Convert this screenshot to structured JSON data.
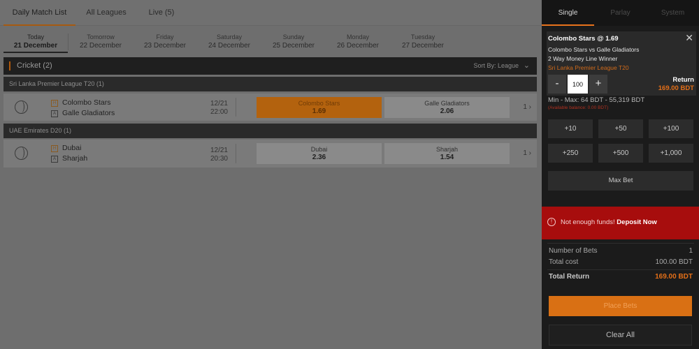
{
  "left": {
    "tabs": [
      {
        "label": "Daily Match List",
        "active": true
      },
      {
        "label": "All Leagues",
        "active": false
      },
      {
        "label": "Live (5)",
        "active": false
      }
    ],
    "dates": [
      {
        "day": "Today",
        "date": "21 December",
        "active": true
      },
      {
        "day": "Tomorrow",
        "date": "22 December"
      },
      {
        "day": "Friday",
        "date": "23 December"
      },
      {
        "day": "Saturday",
        "date": "24 December"
      },
      {
        "day": "Sunday",
        "date": "25 December"
      },
      {
        "day": "Monday",
        "date": "26 December"
      },
      {
        "day": "Tuesday",
        "date": "27 December"
      }
    ],
    "sport": {
      "title": "Cricket (2)",
      "sort_label": "Sort By: League",
      "sort_icon": "chevron-down-icon"
    },
    "leagues": [
      {
        "name": "Sri Lanka Premier League T20 (1)",
        "match": {
          "home": "Colombo Stars",
          "away": "Galle Gladiators",
          "home_badge": "H",
          "away_badge": "A",
          "date": "12/21",
          "time": "22:00",
          "odds": [
            {
              "name": "Colombo Stars",
              "value": "1.69",
              "selected": true
            },
            {
              "name": "Galle Gladiators",
              "value": "2.06",
              "selected": false
            }
          ],
          "more": "1 ›"
        }
      },
      {
        "name": "UAE Emirates D20 (1)",
        "match": {
          "home": "Dubai",
          "away": "Sharjah",
          "home_badge": "H",
          "away_badge": "A",
          "date": "12/21",
          "time": "20:30",
          "odds": [
            {
              "name": "Dubai",
              "value": "2.36",
              "selected": false
            },
            {
              "name": "Sharjah",
              "value": "1.54",
              "selected": false
            }
          ],
          "more": "1 ›"
        }
      }
    ]
  },
  "slip": {
    "tabs": [
      {
        "label": "Single",
        "active": true
      },
      {
        "label": "Parlay",
        "active": false
      },
      {
        "label": "System",
        "active": false
      }
    ],
    "bet": {
      "selection": "Colombo Stars @ 1.69",
      "close": "✕",
      "match": "Colombo Stars vs Galle Gladiators",
      "market": "2 Way Money Line Winner",
      "league": "Sri Lanka Premier League T20",
      "minus": "-",
      "plus": "+",
      "stake": "100",
      "return_label": "Return",
      "return_value": "169.00 BDT"
    },
    "minmax": "Min - Max: 64 BDT - 55,319 BDT",
    "available": "(Available balance: 0.00 BDT)",
    "chips": [
      "+10",
      "+50",
      "+100",
      "+250",
      "+500",
      "+1,000"
    ],
    "max_bet": "Max Bet",
    "warning": {
      "icon": "!",
      "text": "Not enough funds! ",
      "link": "Deposit Now"
    },
    "summary": [
      {
        "label": "Number of Bets",
        "value": "1"
      },
      {
        "label": "Total cost",
        "value": "100.00 BDT"
      },
      {
        "label": "Total Return",
        "value": "169.00 BDT",
        "total": true
      }
    ],
    "place_bets": "Place Bets",
    "clear_all": "Clear All"
  },
  "colors": {
    "accent": "#e36f18",
    "warning_bg": "#a70d0d",
    "slip_bg": "#1b1b1b"
  }
}
